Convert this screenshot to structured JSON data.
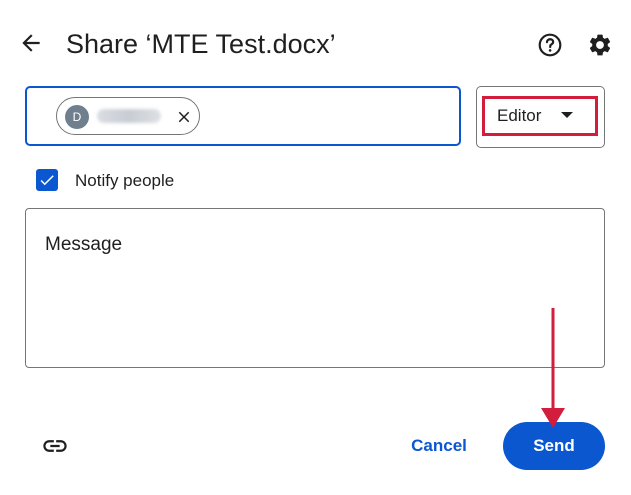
{
  "dialog": {
    "title": "Share ‘MTE Test.docx’"
  },
  "header": {
    "back_icon": "arrow-back-icon",
    "help_icon": "help-icon",
    "settings_icon": "gear-icon"
  },
  "people_input": {
    "chip": {
      "avatar_initial": "D",
      "name_redacted": true,
      "remove_icon": "close-icon"
    }
  },
  "role_selector": {
    "value": "Editor",
    "caret_icon": "caret-down-icon",
    "highlight_color": "#d21e3c"
  },
  "notify": {
    "label": "Notify people",
    "checked": true
  },
  "message": {
    "placeholder": "Message"
  },
  "footer": {
    "copy_link_icon": "link-icon",
    "cancel_label": "Cancel",
    "send_label": "Send"
  },
  "colors": {
    "accent": "#0b57d0",
    "annotation": "#d21e3c",
    "text": "#1f1f1f",
    "border": "#747775"
  }
}
